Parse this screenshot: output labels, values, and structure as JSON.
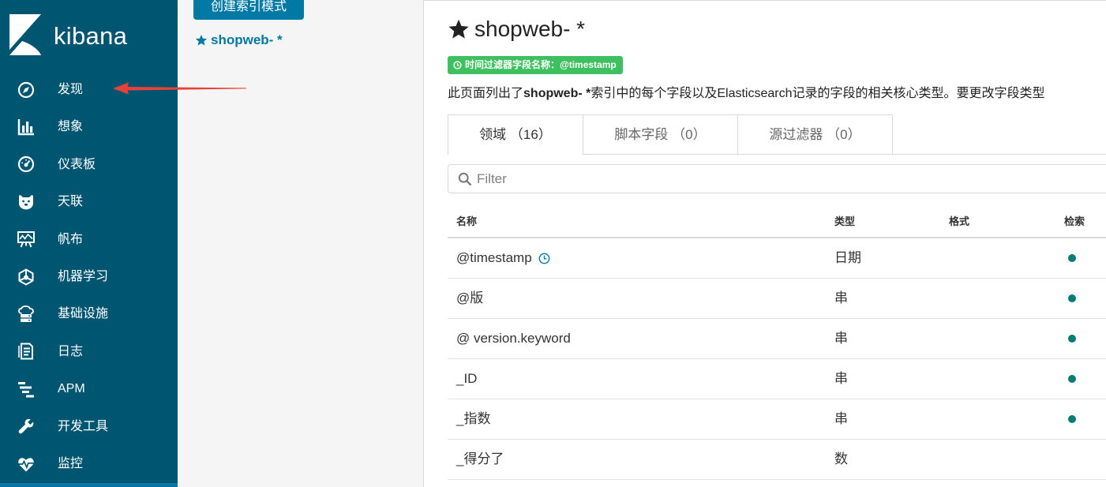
{
  "sidebar": {
    "brand": "kibana",
    "items": [
      {
        "label": "发现",
        "icon": "compass-icon"
      },
      {
        "label": "想象",
        "icon": "bar-chart-icon"
      },
      {
        "label": "仪表板",
        "icon": "gauge-icon"
      },
      {
        "label": "天联",
        "icon": "bear-icon"
      },
      {
        "label": "帆布",
        "icon": "canvas-icon"
      },
      {
        "label": "机器学习",
        "icon": "machine-learning-icon"
      },
      {
        "label": "基础设施",
        "icon": "infrastructure-icon"
      },
      {
        "label": "日志",
        "icon": "logs-icon"
      },
      {
        "label": "APM",
        "icon": "apm-icon"
      },
      {
        "label": "开发工具",
        "icon": "wrench-icon"
      },
      {
        "label": "监控",
        "icon": "heartbeat-icon"
      }
    ]
  },
  "index_patterns": {
    "create_button": "创建索引模式",
    "items": [
      {
        "label": "shopweb- *",
        "default": true,
        "icon": "star-icon"
      }
    ]
  },
  "main": {
    "title": "shopweb- *",
    "title_icon": "star-icon",
    "time_filter_badge": "时间过滤器字段名称：@timestamp",
    "description": {
      "prefix": "此页面列出了",
      "index_name": "shopweb- *",
      "suffix": "索引中的每个字段以及Elasticsearch记录的字段的相关核心类型。要更改字段类型"
    },
    "tabs": [
      {
        "label": "领域 （16）",
        "active": true
      },
      {
        "label": "脚本字段 （0）",
        "active": false
      },
      {
        "label": "源过滤器 （0）",
        "active": false
      }
    ],
    "filter": {
      "placeholder": "Filter",
      "icon": "search-icon"
    },
    "table": {
      "headers": {
        "name": "名称",
        "type": "类型",
        "format": "格式",
        "searchable": "检索"
      },
      "rows": [
        {
          "name": "@timestamp",
          "type": "日期",
          "searchable": true,
          "time_field": true
        },
        {
          "name": "@版",
          "type": "串",
          "searchable": true
        },
        {
          "name": "@ version.keyword",
          "type": "串",
          "searchable": true
        },
        {
          "name": "_ID",
          "type": "串",
          "searchable": true
        },
        {
          "name": "_指数",
          "type": "串",
          "searchable": true
        },
        {
          "name": "_得分了",
          "type": "数",
          "searchable": false
        }
      ]
    }
  },
  "colors": {
    "sidebar_bg": "#005571",
    "accent": "#0079a5",
    "badge_green": "#3ebf60",
    "searchable_dot": "#017d73",
    "annotation_arrow": "#e8413a"
  }
}
